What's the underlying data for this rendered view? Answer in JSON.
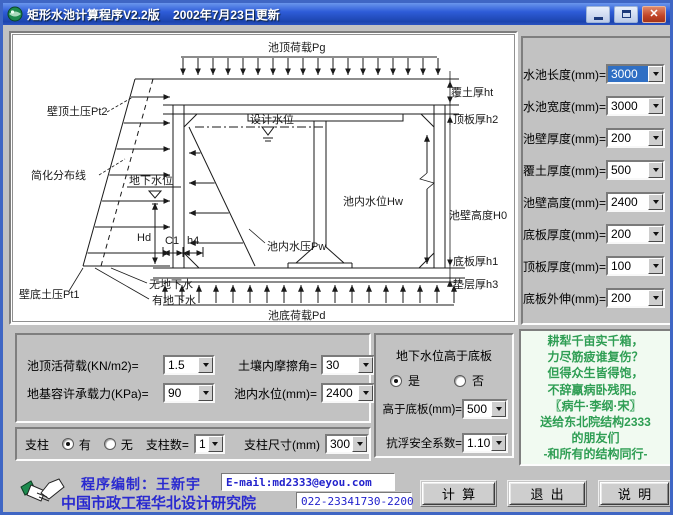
{
  "window": {
    "title": "矩形水池计算程序V2.2版    2002年7月23日更新"
  },
  "diagram": {
    "top_load": "池顶荷载Pg",
    "wall_top_pressure": "壁顶土压Pt2",
    "design_water_level": "设计水位",
    "simplified_line": "简化分布线",
    "groundwater_level": "地下水位",
    "dim_hd": "Hd",
    "dim_c1": "C1",
    "dim_h4": "h4",
    "inner_water_level": "池内水位Hw",
    "inner_water_pressure": "池内水压Pw",
    "wall_bottom_pressure": "壁底土压Pt1",
    "no_groundwater": "无地下水",
    "with_groundwater": "有地下水",
    "bottom_load": "池底荷载Pd",
    "cover_thickness": "覆土厚ht",
    "roof_thickness": "顶板厚h2",
    "wall_height": "池壁高度H0",
    "base_thickness": "底板厚h1",
    "cushion_thickness": "垫层厚h3"
  },
  "right_panel": {
    "fields": [
      {
        "label": "水池长度(mm)=",
        "value": "3000"
      },
      {
        "label": "水池宽度(mm)=",
        "value": "3000"
      },
      {
        "label": "池壁厚度(mm)=",
        "value": "200"
      },
      {
        "label": "覆土厚度(mm)=",
        "value": "500"
      },
      {
        "label": "池壁高度(mm)=",
        "value": "2400"
      },
      {
        "label": "底板厚度(mm)=",
        "value": "200"
      },
      {
        "label": "顶板厚度(mm)=",
        "value": "100"
      },
      {
        "label": "底板外伸(mm)=",
        "value": "200"
      }
    ]
  },
  "load_group": {
    "fields": [
      {
        "label": "池顶活荷载(KN/m2)=",
        "value": "1.5"
      },
      {
        "label": "土壤内摩擦角=",
        "value": "30"
      },
      {
        "label": "地基容许承载力(KPa)=",
        "value": "90"
      },
      {
        "label": "池内水位(mm)=",
        "value": "2400"
      }
    ]
  },
  "groundwater_group": {
    "title": "地下水位高于底板",
    "yes_label": "是",
    "no_label": "否",
    "selected": "是",
    "above_base_label": "高于底板(mm)=",
    "above_base_value": "500",
    "anti_float_label": "抗浮安全系数=",
    "anti_float_value": "1.10"
  },
  "pillar_group": {
    "label": "支柱",
    "yes_label": "有",
    "no_label": "无",
    "selected": "有",
    "count_label": "支柱数=",
    "count_value": "1",
    "size_label": "支柱尺寸(mm)",
    "size_value": "300"
  },
  "poem": {
    "lines": [
      "耕犁千亩实千箱，",
      "力尽筋疲谁复伤？",
      "但得众生皆得饱，",
      "不辞羸病卧残阳。",
      "〖病牛·李纲·宋〗",
      "送给东北院结构2333",
      "的朋友们",
      "-和所有的结构同行-"
    ]
  },
  "footer": {
    "author_line": "程序编制：王新宇",
    "email": "E-mail:md2333@eyou.com",
    "org": "中国市政工程华北设计研究院",
    "phone": "022-23341730-2200",
    "calc_button": "计  算",
    "exit_button": "退  出",
    "help_button": "说  明"
  },
  "colors": {
    "titlebar_blue": "#2e5cd8",
    "selection_blue": "#2f6fc4",
    "poem_green": "#2f9e54",
    "credit_blue": "#2a2ad0",
    "close_red": "#c04326"
  }
}
